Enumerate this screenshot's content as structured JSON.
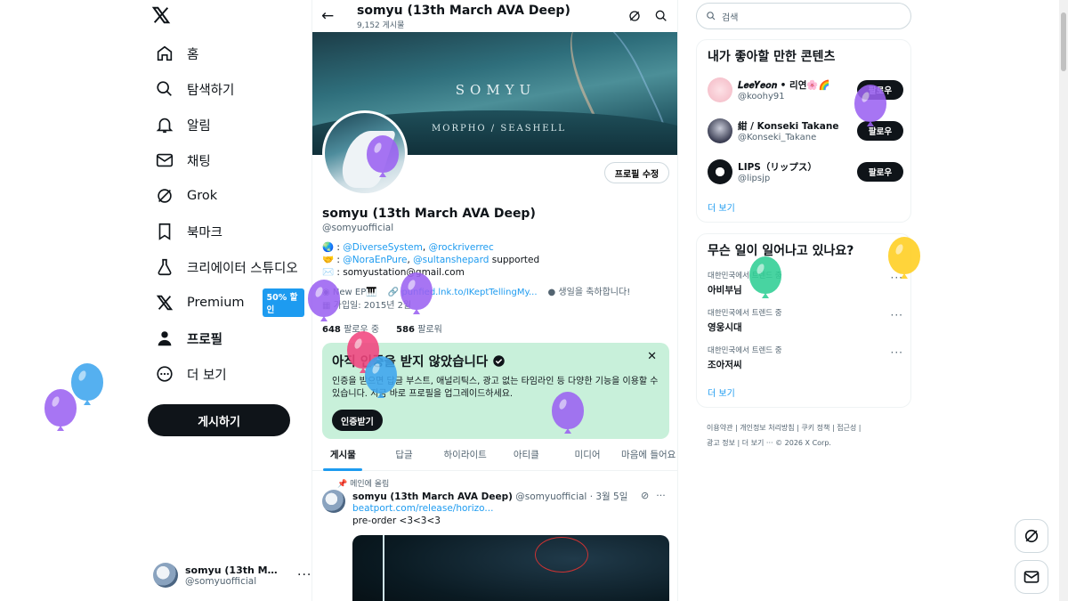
{
  "nav": {
    "items": [
      {
        "label": "홈"
      },
      {
        "label": "탐색하기"
      },
      {
        "label": "알림"
      },
      {
        "label": "채팅"
      },
      {
        "label": "Grok"
      },
      {
        "label": "북마크"
      },
      {
        "label": "크리에이터 스튜디오"
      },
      {
        "label": "Premium",
        "badge": "50% 할인"
      },
      {
        "label": "프로필"
      },
      {
        "label": "더 보기"
      }
    ],
    "post_button": "게시하기",
    "account": {
      "name": "somyu (13th March ...",
      "handle": "@somyuofficial"
    }
  },
  "main": {
    "header": {
      "name": "somyu (13th March AVA Deep)",
      "post_count": "9,152 게시물"
    },
    "banner": {
      "title": "SOMYU",
      "subtitle": "MORPHO / SEASHELL"
    },
    "edit_profile": "프로필 수정",
    "profile": {
      "name": "somyu (13th March AVA Deep)",
      "handle": "@somyuofficial",
      "bio1_prefix": "🌏 : ",
      "bio1_link1": "@DiverseSystem",
      "bio1_sep": ", ",
      "bio1_link2": "@rockriverrec",
      "bio2_prefix": "🤝 : ",
      "bio2_link1": "@NoraEnPure",
      "bio2_sep": ", ",
      "bio2_link2": "@sultanshepard",
      "bio2_suffix": " supported",
      "bio3": "✉️ : somyustation@gmail.com",
      "location": "New EP🎹",
      "website": "punfied.lnk.to/IKeptTellingMy...",
      "birthday": "생일을 축하합니다!",
      "joined": "가입일: 2015년 2월",
      "following_count": "648",
      "following_label": "팔로우 중",
      "followers_count": "586",
      "followers_label": "팔로워"
    },
    "verify": {
      "title": "아직 인증을 받지 않았습니다",
      "text": "인증을 받으면 답글 부스트, 애널리틱스, 광고 없는 타임라인 등 다양한 기능을 이용할 수 있습니다. 지금 바로 프로필을 업그레이드하세요.",
      "button": "인증받기"
    },
    "tabs": [
      "게시물",
      "답글",
      "하이라이트",
      "아티클",
      "미디어",
      "마음에 들어요"
    ],
    "pinned_label": "메인에 올림",
    "tweet": {
      "name": "somyu (13th March AVA Deep)",
      "handle": "@somyuofficial",
      "date": "· 3월 5일",
      "link": "beatport.com/release/horizo...",
      "text": "pre-order <3<3<3"
    }
  },
  "right": {
    "search_placeholder": "검색",
    "who_to_follow": {
      "title": "내가 좋아할 만한 콘텐츠",
      "users": [
        {
          "name": "𝑳𝒆𝒆𝒀𝒆𝒐𝒏 • 리연🌸🌈",
          "handle": "@koohy91",
          "button": "팔로우"
        },
        {
          "name": "紺 / Konseki Takane",
          "handle": "@Konseki_Takane",
          "button": "팔로우"
        },
        {
          "name": "LIPS（リップス）",
          "handle": "@lipsjp",
          "button": "팔로우"
        }
      ],
      "more": "더 보기"
    },
    "trends": {
      "title": "무슨 일이 일어나고 있나요?",
      "items": [
        {
          "category": "대한민국에서 트렌드 중",
          "name": "아비부님"
        },
        {
          "category": "대한민국에서 트렌드 중",
          "name": "영웅시대"
        },
        {
          "category": "대한민국에서 트렌드 중",
          "name": "조아저씨"
        }
      ],
      "more": "더 보기"
    },
    "footer": {
      "line1": "이용약관  |  개인정보 처리방침  |  쿠키 정책  |  접근성  |",
      "line2": "광고 정보  |  더 보기 ···  © 2026 X Corp."
    }
  },
  "colors": {
    "accent": "#1d9bf0",
    "verify_bg": "#c8f0da",
    "primary": "#0f1419"
  }
}
